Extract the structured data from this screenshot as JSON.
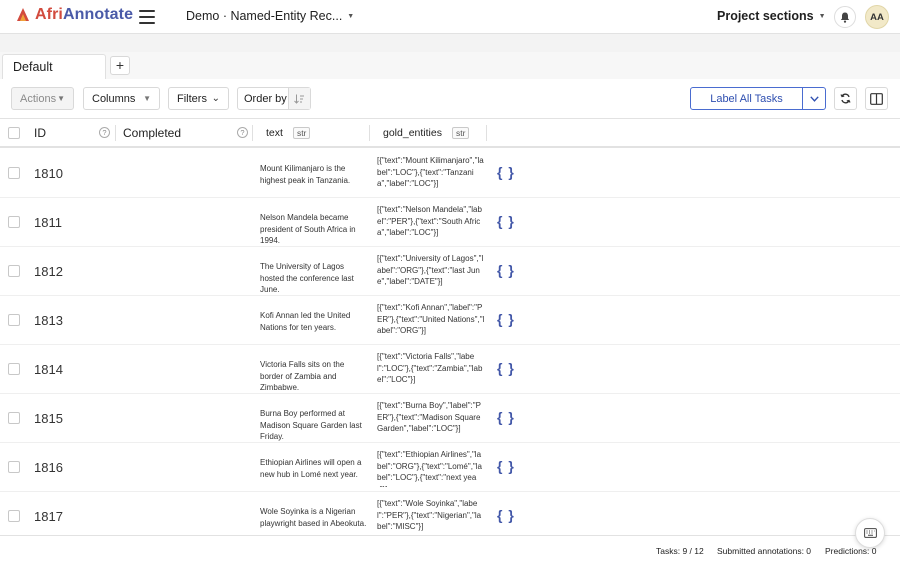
{
  "app": {
    "logo_afri": "Afri",
    "logo_annotate": "Annotate",
    "project_title": "Demo · Named-Entity Rec...",
    "project_sections": "Project sections",
    "avatar_initials": "AA"
  },
  "tabs": [
    {
      "label": "Default"
    }
  ],
  "tab_add_label": "+",
  "toolbar": {
    "actions_label": "Actions",
    "columns_label": "Columns",
    "filters_label": "Filters",
    "order_by_label": "Order by",
    "label_all_label": "Label All Tasks"
  },
  "columns": {
    "id": "ID",
    "completed": "Completed",
    "text": "text",
    "text_type": "str",
    "gold": "gold_entities",
    "gold_type": "str",
    "help_glyph": "?"
  },
  "rows": [
    {
      "id": "1810",
      "text": "Mount Kilimanjaro is the highest peak in Tanzania.",
      "gold": "[{\"text\":\"Mount Kilimanjaro\",\"label\":\"LOC\"},{\"text\":\"Tanzania\",\"label\":\"LOC\"}]",
      "brace": "{ }"
    },
    {
      "id": "1811",
      "text": "Nelson Mandela became president of South Africa in 1994.",
      "gold": "[{\"text\":\"Nelson Mandela\",\"label\":\"PER\"},{\"text\":\"South Africa\",\"label\":\"LOC\"}]",
      "brace": "{ }"
    },
    {
      "id": "1812",
      "text": "The University of Lagos hosted the conference last June.",
      "gold": "[{\"text\":\"University of Lagos\",\"label\":\"ORG\"},{\"text\":\"last June\",\"label\":\"DATE\"}]",
      "brace": "{ }"
    },
    {
      "id": "1813",
      "text": "Kofi Annan led the United Nations for ten years.",
      "gold": "[{\"text\":\"Kofi Annan\",\"label\":\"PER\"},{\"text\":\"United Nations\",\"label\":\"ORG\"}]",
      "brace": "{ }"
    },
    {
      "id": "1814",
      "text": "Victoria Falls sits on the border of Zambia and Zimbabwe.",
      "gold": "[{\"text\":\"Victoria Falls\",\"label\":\"LOC\"},{\"text\":\"Zambia\",\"label\":\"LOC\"}]",
      "brace": "{ }"
    },
    {
      "id": "1815",
      "text": "Burna Boy performed at Madison Square Garden last Friday.",
      "gold": "[{\"text\":\"Burna Boy\",\"label\":\"PER\"},{\"text\":\"Madison Square Garden\",\"label\":\"LOC\"}]",
      "brace": "{ }"
    },
    {
      "id": "1816",
      "text": "Ethiopian Airlines will open a new hub in Lomé next year.",
      "gold": "[{\"text\":\"Ethiopian Airlines\",\"label\":\"ORG\"},{\"text\":\"Lomé\",\"label\":\"LOC\"},{\"text\":\"next year\"}]",
      "brace": "{ }"
    },
    {
      "id": "1817",
      "text": "Wole Soyinka is a Nigerian playwright based in Abeokuta.",
      "gold": "[{\"text\":\"Wole Soyinka\",\"label\":\"PER\"},{\"text\":\"Nigerian\",\"label\":\"MISC\"}]",
      "brace": "{ }"
    }
  ],
  "footer": {
    "tasks": "Tasks: 9 / 12",
    "submitted": "Submitted annotations: 0",
    "predictions": "Predictions: 0"
  },
  "icons": [
    "hamburger-icon",
    "bell-icon",
    "sort-icon",
    "refresh-icon",
    "columns-toggle-icon",
    "keyboard-icon",
    "json-brace-icon"
  ],
  "colors": {
    "brand_red": "#d24b3e",
    "brand_blue": "#4a5aa8",
    "accent": "#4a6cd0"
  }
}
